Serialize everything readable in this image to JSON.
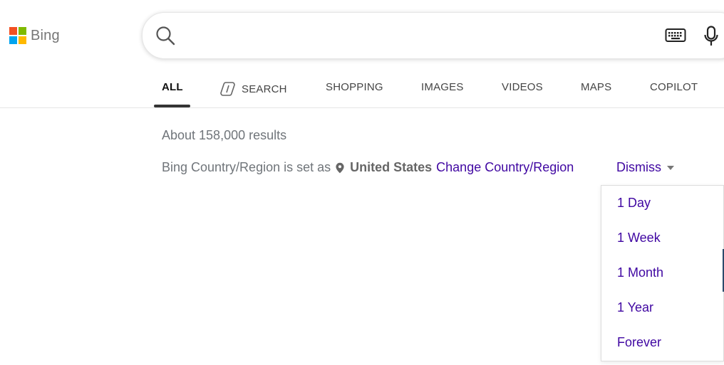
{
  "brand": {
    "name": "Bing"
  },
  "search": {
    "value": "",
    "placeholder": ""
  },
  "tabs": [
    {
      "label": "ALL",
      "active": true
    },
    {
      "label": "SEARCH",
      "icon": "copilot-icon"
    },
    {
      "label": "SHOPPING"
    },
    {
      "label": "IMAGES"
    },
    {
      "label": "VIDEOS"
    },
    {
      "label": "MAPS"
    },
    {
      "label": "COPILOT"
    }
  ],
  "results": {
    "count_text": "About 158,000 results"
  },
  "region": {
    "prefix": "Bing Country/Region is set as",
    "country": "United States",
    "change_link": "Change Country/Region",
    "dismiss_label": "Dismiss"
  },
  "dismiss_menu": {
    "items": [
      {
        "label": "1 Day"
      },
      {
        "label": "1 Week"
      },
      {
        "label": "1 Month"
      },
      {
        "label": "1 Year"
      },
      {
        "label": "Forever"
      }
    ]
  },
  "colors": {
    "link": "#4007a2",
    "muted_text": "#70757a",
    "ms_red": "#f25022",
    "ms_green": "#7fba00",
    "ms_blue": "#00a4ef",
    "ms_yellow": "#ffb900"
  }
}
